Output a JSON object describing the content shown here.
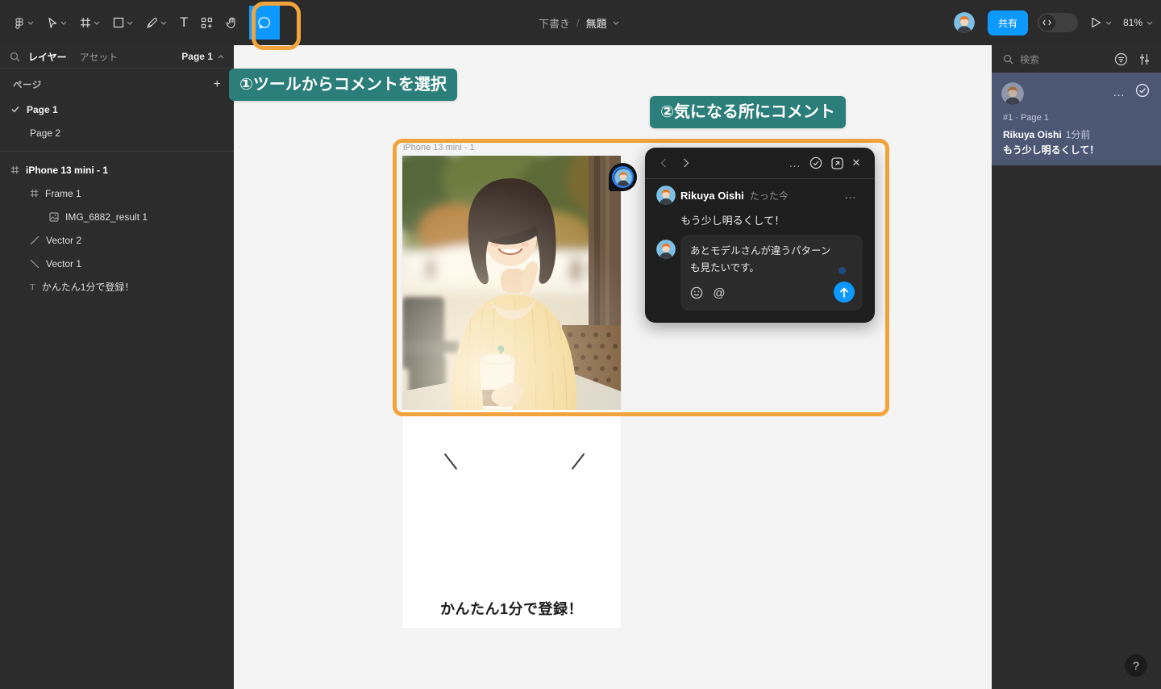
{
  "toolbar": {
    "breadcrumb": {
      "project": "下書き",
      "separator": "/",
      "file": "無題"
    },
    "share_label": "共有",
    "zoom_level": "81%",
    "text_tool_glyph": "T"
  },
  "left_sidebar": {
    "tabs": {
      "layers": "レイヤー",
      "assets": "アセット"
    },
    "page_selector": "Page 1",
    "pages_header": "ページ",
    "pages": [
      {
        "name": "Page 1",
        "selected": true
      },
      {
        "name": "Page 2",
        "selected": false
      }
    ],
    "layers": [
      {
        "name": "iPhone 13 mini - 1",
        "icon": "frame-icon"
      },
      {
        "name": "Frame 1",
        "icon": "frame-icon"
      },
      {
        "name": "IMG_6882_result 1",
        "icon": "image-icon"
      },
      {
        "name": "Vector 2",
        "icon": "vector-line-icon"
      },
      {
        "name": "Vector 1",
        "icon": "vector-line-icon"
      },
      {
        "name": "かんたん1分で登録！",
        "icon": "text-icon"
      }
    ]
  },
  "canvas": {
    "annotation_step1": "①ツールからコメントを選択",
    "annotation_step2": "②気になる所にコメント",
    "frame_label": "iPhone 13 mini - 1",
    "frame_headline": "かんたん1分で登録！"
  },
  "comment_popup": {
    "author": "Rikuya Oishi",
    "timestamp": "たった今",
    "message": "もう少し明るくして！",
    "reply_draft": "あとモデルさんが違うパターンも見たいです。"
  },
  "comments_panel": {
    "search_placeholder": "検索",
    "comment": {
      "thread_id": "#1 · Page 1",
      "author": "Rikuya Oishi",
      "timestamp": "1分前",
      "message": "もう少し明るくして！"
    }
  },
  "help_label": "?",
  "icons": {
    "more": "…",
    "close": "✕",
    "at": "@",
    "plus": "+"
  },
  "colors": {
    "accent_blue": "#0d99ff",
    "annotation_teal": "#2b7e7a",
    "highlight_orange": "#f2a43c",
    "selected_comment_bg": "#4c5873",
    "toolbar_bg": "#2b2b2b"
  }
}
